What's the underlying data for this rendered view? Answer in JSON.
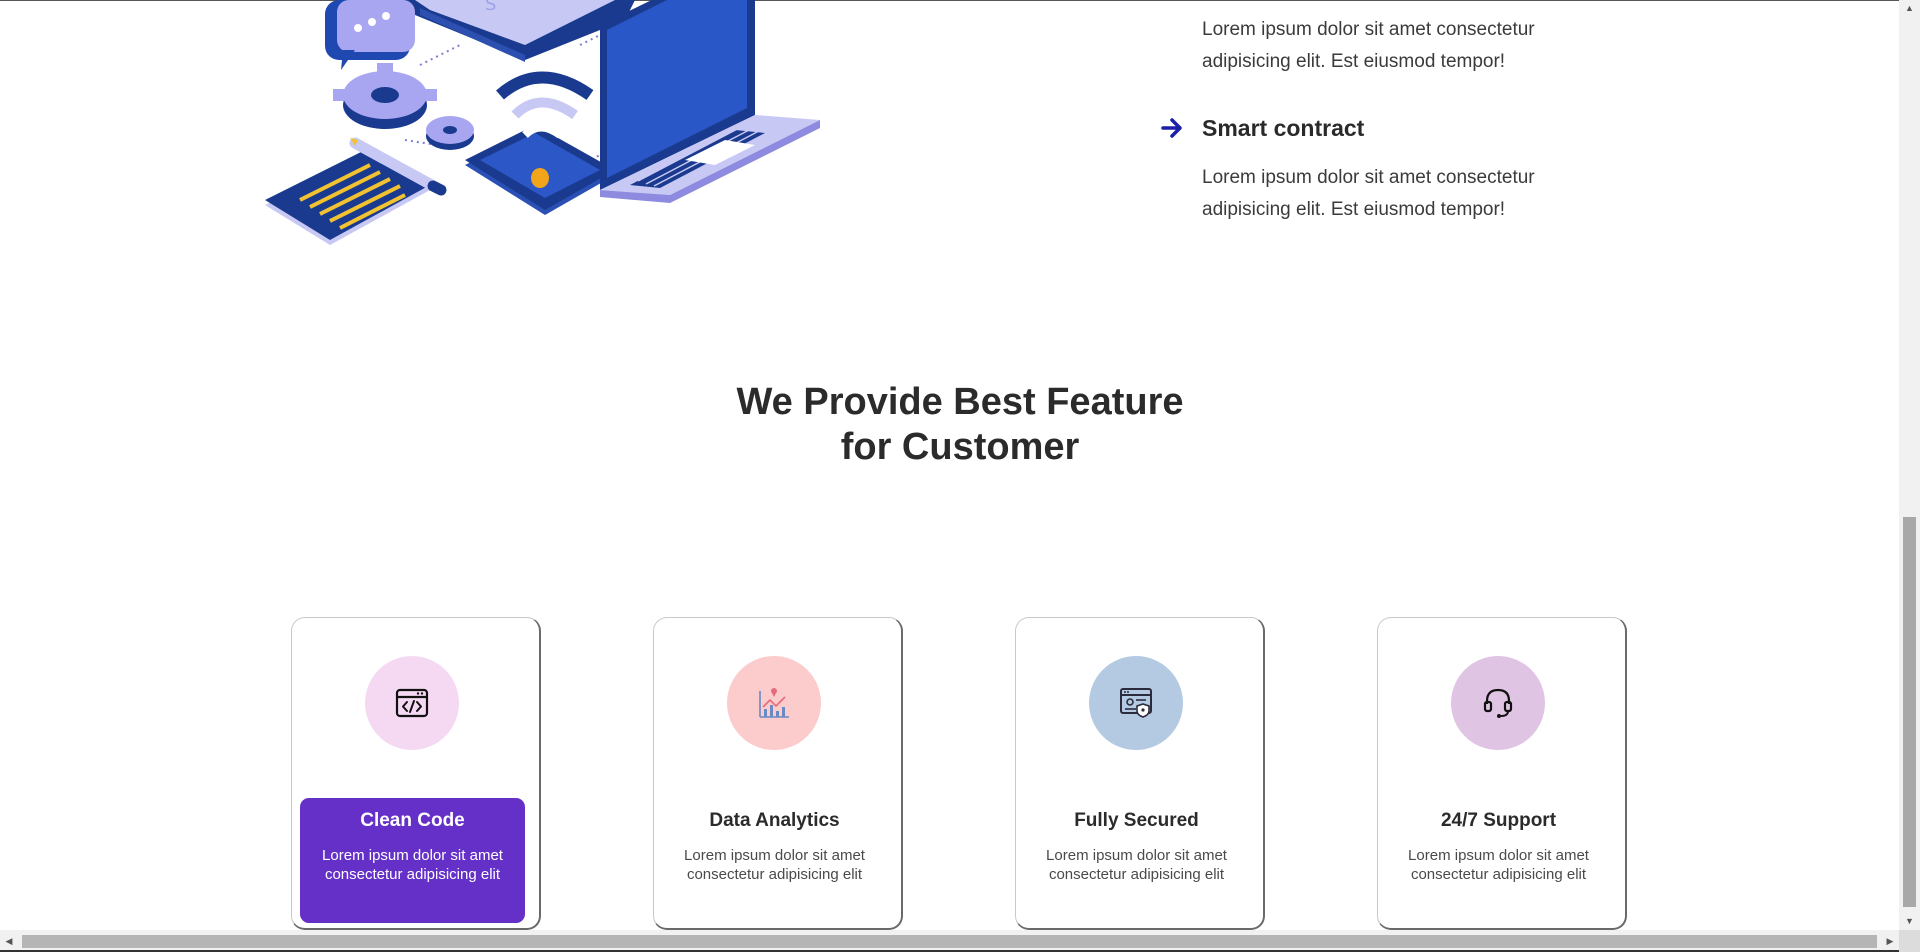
{
  "feature_list": {
    "first_description": "Lorem ipsum dolor sit amet consectetur adipisicing elit. Est eiusmod tempor!",
    "items": [
      {
        "title": "Smart contract",
        "description": "Lorem ipsum dolor sit amet consectetur adipisicing elit. Est eiusmod tempor!",
        "icon": "arrow-right-icon"
      }
    ]
  },
  "section": {
    "title_line1": "We Provide Best Feature",
    "title_line2": "for Customer"
  },
  "cards": [
    {
      "title": "Clean Code",
      "description": "Lorem ipsum dolor sit amet consectetur adipisicing elit",
      "icon": "code-window-icon",
      "circle_color": "#f5d9f3",
      "active": true
    },
    {
      "title": "Data Analytics",
      "description": "Lorem ipsum dolor sit amet consectetur adipisicing elit",
      "icon": "analytics-chart-icon",
      "circle_color": "#fccbcb",
      "active": false
    },
    {
      "title": "Fully Secured",
      "description": "Lorem ipsum dolor sit amet consectetur adipisicing elit",
      "icon": "secure-browser-icon",
      "circle_color": "#b4cae2",
      "active": false
    },
    {
      "title": "24/7 Support",
      "description": "Lorem ipsum dolor sit amet consectetur adipisicing elit",
      "icon": "headset-icon",
      "circle_color": "#e0c4e3",
      "active": false
    }
  ],
  "colors": {
    "accent_purple": "#6430c8",
    "arrow_blue": "#1c1fa8",
    "text_dark": "#2b2b2b"
  }
}
